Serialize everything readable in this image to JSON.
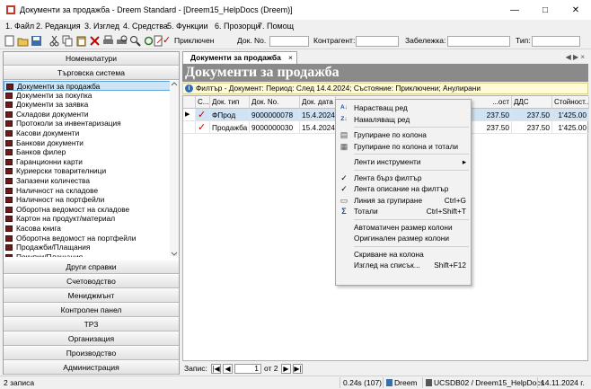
{
  "window": {
    "title": "Документи за продажба - Dreem Standard - [Dreem15_HelpDocs (Dreem)]"
  },
  "menu": [
    "1. Файл",
    "2. Редакция",
    "3. Изглед",
    "4. Средства",
    "5. Функции",
    "6. Прозорци",
    "7. Помощ"
  ],
  "toolbar": {
    "status_label": "Приключен",
    "doc_no_label": "Док. No.",
    "contractor_label": "Контрагент:",
    "note_label": "Забележка:",
    "type_label": "Тип:"
  },
  "left": {
    "nomenclatures": "Номенклатури",
    "trade_system": "Търговска система",
    "items": [
      "Документи за продажба",
      "Документи за покупка",
      "Документи за заявка",
      "Складови документи",
      "Протоколи за инвентаризация",
      "Касови документи",
      "Банкови документи",
      "Банков филер",
      "Гаранционни карти",
      "Куриерски товарителници",
      "Запазени количества",
      "Наличност на складове",
      "Наличност на портфейли",
      "Оборотна ведомост на складове",
      "Картон на продукт/материал",
      "Касова книга",
      "Оборотна ведомост на портфейли",
      "Продажби/Плащания",
      "Покупки/Плащания"
    ],
    "sections": [
      "Други справки",
      "Счетоводство",
      "Мениджмънт",
      "Контролен панел",
      "ТРЗ",
      "Организация",
      "Производство",
      "Администрация"
    ]
  },
  "main": {
    "tab": "Документи за продажба",
    "header": "Документи за продажба",
    "filter": "Филтър - Документ: Период: След 14.4.2024; Състояние: Приключени; Анулирани",
    "columns": [
      "С...",
      "Док. тип",
      "Док. No.",
      "Док. дата",
      "...ост",
      "ДДС",
      "Стойност..."
    ],
    "rows": [
      [
        "ФПрод",
        "9000000078",
        "15.4.2024",
        "237.50",
        "237.50",
        "1'425.00"
      ],
      [
        "Продажба",
        "9000000030",
        "15.4.2024",
        "237.50",
        "237.50",
        "1'425.00"
      ]
    ],
    "pager": {
      "label": "Запис:",
      "current": "1",
      "of": "от 2"
    }
  },
  "context_menu": [
    {
      "label": "Нарастващ ред",
      "icon": "sort-asc-icon",
      "sym": "A↓"
    },
    {
      "label": "Намаляващ ред",
      "icon": "sort-desc-icon",
      "sym": "Z↓"
    },
    {
      "sep": true
    },
    {
      "label": "Групиране по колона",
      "icon": "group-icon",
      "sym": "▤"
    },
    {
      "label": "Групиране по колона и тотали",
      "icon": "group-totals-icon",
      "sym": "▦"
    },
    {
      "sep": true
    },
    {
      "label": "Ленти инструменти",
      "icon": "",
      "sym": "",
      "arrow": true
    },
    {
      "sep": true
    },
    {
      "label": "Лента бърз филтър",
      "icon": "check-icon",
      "sym": "✓"
    },
    {
      "label": "Лента описание на филтър",
      "icon": "check-icon",
      "sym": "✓"
    },
    {
      "label": "Линия за групиране",
      "icon": "grouping-line-icon",
      "sym": "▭",
      "shortcut": "Ctrl+G"
    },
    {
      "label": "Тотали",
      "icon": "sigma-icon",
      "sym": "Σ",
      "shortcut": "Ctrl+Shift+T"
    },
    {
      "sep": true
    },
    {
      "label": "Автоматичен размер колони",
      "icon": "",
      "sym": ""
    },
    {
      "label": "Оригинален размер колони",
      "icon": "",
      "sym": ""
    },
    {
      "sep": true
    },
    {
      "label": "Скриване на колона",
      "icon": "",
      "sym": ""
    },
    {
      "label": "Изглед на списък...",
      "icon": "",
      "sym": "",
      "shortcut": "Shift+F12"
    }
  ],
  "status": {
    "records": "2 записа",
    "timing": "0.24s (107)",
    "db_name": "Dreem",
    "server": "UCSDB02 / Dreem15_HelpDocs",
    "date": "14.11.2024 г."
  },
  "colors": {
    "selection": "#cde6f7",
    "header_bg": "#8a8a8a",
    "filter_bg": "#fffbd6",
    "doc_icon": "#6b1d1d",
    "check": "#c00000"
  }
}
